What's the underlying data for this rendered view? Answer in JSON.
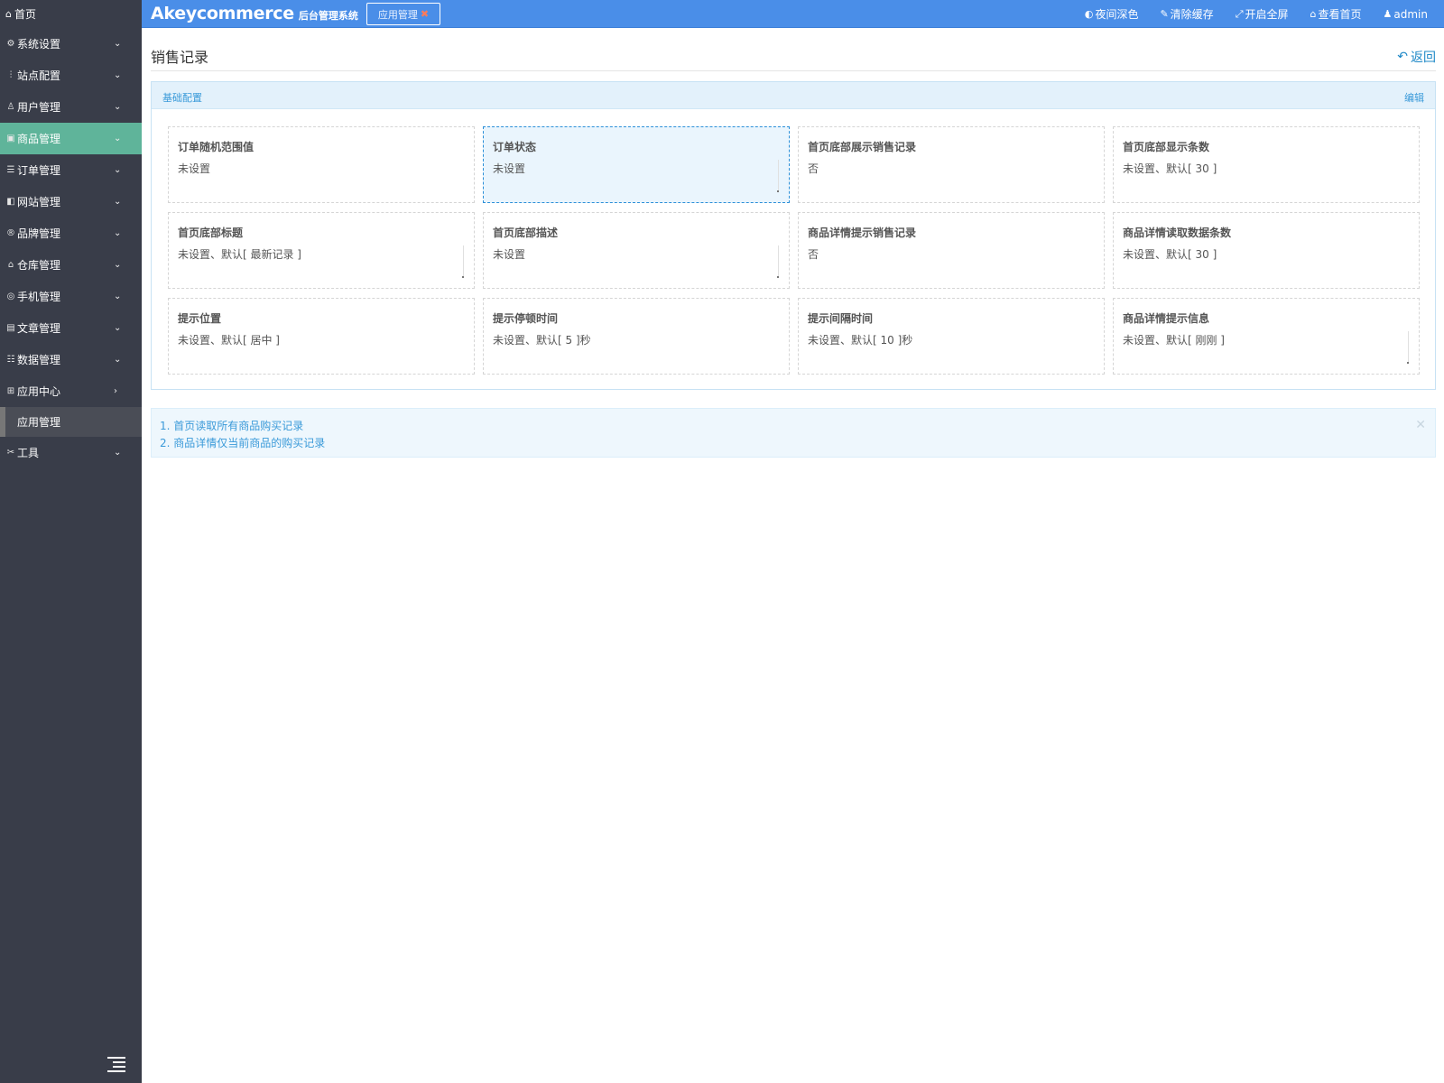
{
  "sidebar": {
    "home": "首页",
    "items": [
      {
        "label": "系统设置",
        "icon": "gear-icon",
        "glyph": "⚙",
        "chevron": "⌄",
        "active": false
      },
      {
        "label": "站点配置",
        "icon": "sliders-icon",
        "glyph": "⫶",
        "chevron": "⌄",
        "active": false
      },
      {
        "label": "用户管理",
        "icon": "user-icon",
        "glyph": "♙",
        "chevron": "⌄",
        "active": false
      },
      {
        "label": "商品管理",
        "icon": "product-icon",
        "glyph": "▣",
        "chevron": "⌄",
        "active": true
      },
      {
        "label": "订单管理",
        "icon": "order-icon",
        "glyph": "☰",
        "chevron": "⌄",
        "active": false
      },
      {
        "label": "网站管理",
        "icon": "site-icon",
        "glyph": "◧",
        "chevron": "⌄",
        "active": false
      },
      {
        "label": "品牌管理",
        "icon": "brand-icon",
        "glyph": "®",
        "chevron": "⌄",
        "active": false
      },
      {
        "label": "仓库管理",
        "icon": "warehouse-icon",
        "glyph": "⌂",
        "chevron": "⌄",
        "active": false
      },
      {
        "label": "手机管理",
        "icon": "mobile-icon",
        "glyph": "◎",
        "chevron": "⌄",
        "active": false
      },
      {
        "label": "文章管理",
        "icon": "article-icon",
        "glyph": "▤",
        "chevron": "⌄",
        "active": false
      },
      {
        "label": "数据管理",
        "icon": "database-icon",
        "glyph": "☷",
        "chevron": "⌄",
        "active": false
      },
      {
        "label": "应用中心",
        "icon": "apps-icon",
        "glyph": "⊞",
        "chevron": "›",
        "active": false
      }
    ],
    "sub_item": "应用管理",
    "tools": {
      "label": "工具",
      "glyph": "✂",
      "chevron": "⌄"
    }
  },
  "header": {
    "brand": "Akeycommerce",
    "brand_sub": "后台管理系统",
    "tab_label": "应用管理",
    "tab_close": "✖",
    "actions": [
      {
        "label": "夜间深色",
        "icon": "contrast-icon",
        "glyph": "◐"
      },
      {
        "label": "清除缓存",
        "icon": "brush-icon",
        "glyph": "✎"
      },
      {
        "label": "开启全屏",
        "icon": "fullscreen-icon",
        "glyph": "⤢"
      },
      {
        "label": "查看首页",
        "icon": "home-icon",
        "glyph": "⌂"
      },
      {
        "label": "admin",
        "icon": "user-icon",
        "glyph": "♟"
      }
    ]
  },
  "page": {
    "title": "销售记录",
    "back": "返回",
    "back_glyph": "↶"
  },
  "panel": {
    "title": "基础配置",
    "edit": "编辑",
    "cards": [
      {
        "title": "订单随机范围值",
        "value": "未设置",
        "selected": false,
        "grip": false
      },
      {
        "title": "订单状态",
        "value": "未设置",
        "selected": true,
        "grip": true
      },
      {
        "title": "首页底部展示销售记录",
        "value": "否",
        "selected": false,
        "grip": false
      },
      {
        "title": "首页底部显示条数",
        "value": "未设置、默认[ 30 ]",
        "selected": false,
        "grip": false
      },
      {
        "title": "首页底部标题",
        "value": "未设置、默认[ 最新记录 ]",
        "selected": false,
        "grip": true
      },
      {
        "title": "首页底部描述",
        "value": "未设置",
        "selected": false,
        "grip": true
      },
      {
        "title": "商品详情提示销售记录",
        "value": "否",
        "selected": false,
        "grip": false
      },
      {
        "title": "商品详情读取数据条数",
        "value": "未设置、默认[ 30 ]",
        "selected": false,
        "grip": false
      },
      {
        "title": "提示位置",
        "value": "未设置、默认[ 居中 ]",
        "selected": false,
        "grip": false
      },
      {
        "title": "提示停顿时间",
        "value": "未设置、默认[ 5 ]秒",
        "selected": false,
        "grip": false
      },
      {
        "title": "提示间隔时间",
        "value": "未设置、默认[ 10 ]秒",
        "selected": false,
        "grip": false
      },
      {
        "title": "商品详情提示信息",
        "value": "未设置、默认[ 刚刚 ]",
        "selected": false,
        "grip": true
      }
    ]
  },
  "notice": {
    "lines": [
      "1. 首页读取所有商品购买记录",
      "2. 商品详情仅当前商品的购买记录"
    ],
    "close": "✕"
  },
  "colors": {
    "sidebar_bg": "#393d49",
    "header_bg": "#4a8ee8",
    "active_nav": "#5fb49a",
    "accent_blue": "#3a9ad9"
  }
}
